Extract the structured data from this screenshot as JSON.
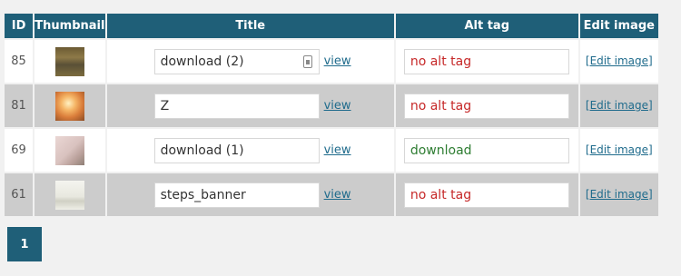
{
  "columns": {
    "id": "ID",
    "thumbnail": "Thumbnail",
    "title": "Title",
    "alt": "Alt tag",
    "edit": "Edit image"
  },
  "rows": [
    {
      "id": "85",
      "title": "download (2)",
      "view": "view",
      "alt": "no alt tag",
      "alt_missing": true,
      "edit": "[Edit image]"
    },
    {
      "id": "81",
      "title": "Z",
      "view": "view",
      "alt": "no alt tag",
      "alt_missing": true,
      "edit": "[Edit image]"
    },
    {
      "id": "69",
      "title": "download (1)",
      "view": "view",
      "alt": "download",
      "alt_missing": false,
      "edit": "[Edit image]"
    },
    {
      "id": "61",
      "title": "steps_banner",
      "view": "view",
      "alt": "no alt tag",
      "alt_missing": true,
      "edit": "[Edit image]"
    }
  ],
  "pagination": {
    "current": "1"
  },
  "colors": {
    "header_bg": "#1f5f78",
    "missing_alt": "#c62828",
    "present_alt": "#2e7d32",
    "link": "#1f6b8c"
  }
}
